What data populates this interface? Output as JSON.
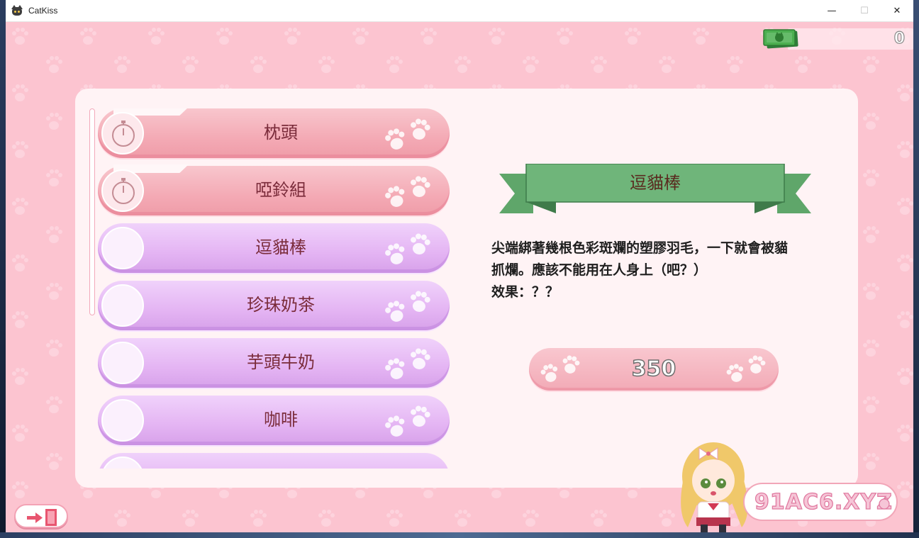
{
  "window": {
    "title": "CatKiss",
    "controls": {
      "minimize": "—",
      "maximize": "☐",
      "close": "✕"
    }
  },
  "money": {
    "value": "0",
    "icon": "cash-icon"
  },
  "shop_list": {
    "items": [
      {
        "label": "枕頭",
        "state": "locked",
        "icon": "stopwatch-icon"
      },
      {
        "label": "啞鈴組",
        "state": "locked",
        "icon": "stopwatch-icon"
      },
      {
        "label": "逗貓棒",
        "state": "available",
        "icon": ""
      },
      {
        "label": "珍珠奶茶",
        "state": "available",
        "icon": ""
      },
      {
        "label": "芋頭牛奶",
        "state": "available",
        "icon": ""
      },
      {
        "label": "咖啡",
        "state": "available",
        "icon": ""
      },
      {
        "label": "",
        "state": "available",
        "icon": ""
      }
    ]
  },
  "detail": {
    "title": "逗貓棒",
    "description_lines": [
      "尖端綁著幾根色彩斑斕的塑膠羽毛，一下就會被貓",
      "抓爛。應該不能用在人身上（吧？）",
      "效果：？？"
    ],
    "price": "350"
  },
  "exit_button": {
    "icon": "exit-door-icon"
  },
  "watermark": {
    "text": "91AC6.XYZ"
  },
  "colors": {
    "background": "#fcc4d0",
    "panel": "#fff3f5",
    "locked_item": "#f4aab5",
    "available_item": "#e4b4f3",
    "ribbon": "#5fa66a",
    "text_item": "#7a2b3a"
  }
}
